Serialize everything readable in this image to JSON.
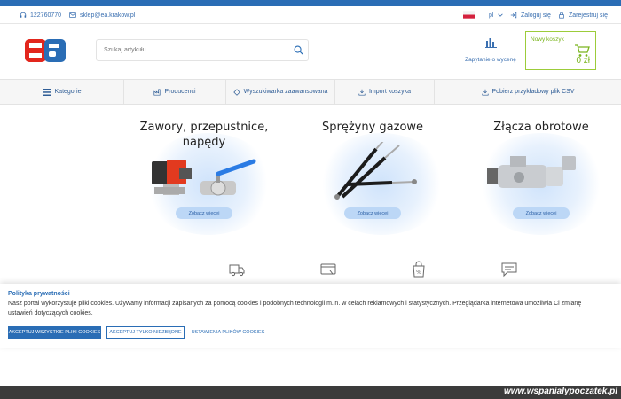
{
  "topbar": {
    "phone": "122760770",
    "email": "sklep@ea.krakow.pl",
    "language": "pl",
    "login": "Zaloguj się",
    "register": "Zarejestruj się"
  },
  "header": {
    "search_placeholder": "Szukaj artykułu...",
    "quote_label": "Zapytanie o wycenę",
    "cart_title": "Nowy koszyk",
    "cart_value": "0 zł"
  },
  "nav": {
    "items": [
      {
        "label": "Kategorie",
        "icon": "hamburger-icon"
      },
      {
        "label": "Producenci",
        "icon": "factory-icon"
      },
      {
        "label": "Wyszukiwarka zaawansowana",
        "icon": "diamond-icon"
      },
      {
        "label": "Import koszyka",
        "icon": "download-icon"
      },
      {
        "label": "Pobierz przykładowy plik CSV",
        "icon": "download-icon"
      }
    ]
  },
  "categories": [
    {
      "title_line1": "Zawory, przepustnice,",
      "title_line2": "napędy",
      "button": "Zobacz więcej"
    },
    {
      "title_line1": "Sprężyny gazowe",
      "title_line2": "",
      "button": "Zobacz więcej"
    },
    {
      "title_line1": "Złącza obrotowe",
      "title_line2": "",
      "button": "Zobacz więcej"
    }
  ],
  "cookie": {
    "title": "Polityka prywatności",
    "text": "Nasz portal wykorzystuje pliki cookies. Używamy informacji zapisanych za pomocą cookies i podobnych technologii m.in. w celach reklamowych i statystycznych. Przeglądarka internetowa umożliwia Ci zmianę ustawień dotyczących cookies.",
    "accept_all": "AKCEPTUJ WSZYSTKIE PLIKI COOKIES",
    "accept_necessary": "AKCEPTUJ TYLKO NIEZBĘDNE",
    "settings": "USTAWIENIA PLIKÓW COOKIES"
  },
  "watermark": "www.wspanialypoczatek.pl",
  "colors": {
    "accent": "#2a6db5",
    "cart_green": "#7ab51d",
    "logo_red": "#e2261d",
    "logo_blue": "#2a6db5"
  }
}
